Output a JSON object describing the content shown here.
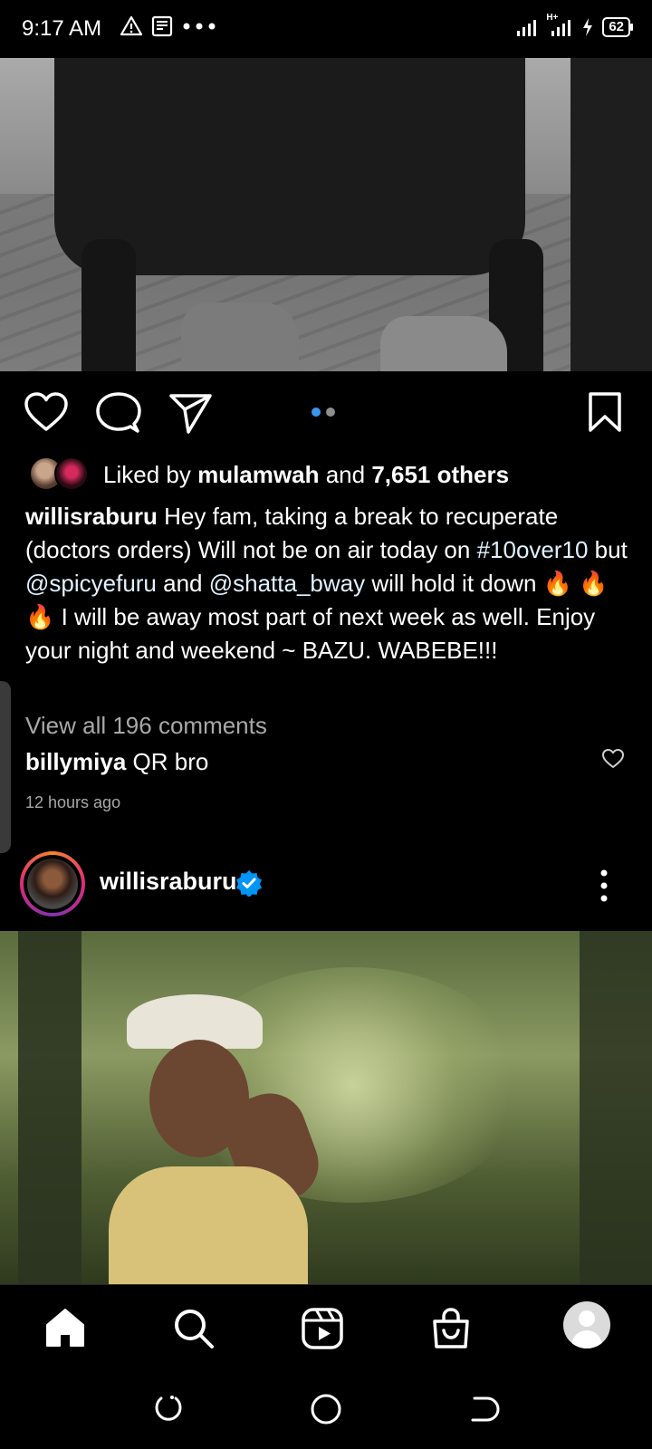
{
  "status_bar": {
    "time": "9:17 AM",
    "left_icons": [
      "alert-triangle-icon",
      "news-icon",
      "more-dots-icon"
    ],
    "right_icons": [
      "signal-icon",
      "signal-hplus-icon",
      "charging-icon"
    ],
    "network_label": "H+",
    "battery": "62"
  },
  "post1": {
    "image_icon": "photo-chair-boots",
    "carousel": {
      "total": 2,
      "active": 1
    },
    "likes": {
      "prefix": "Liked by",
      "user": "mulamwah",
      "and": "and",
      "others": "7,651 others"
    },
    "caption": {
      "username": "willisraburu",
      "part1": " Hey fam, taking a break to recuperate (doctors orders) Will not be on air today on ",
      "hashtag": "#10over10",
      "part2": " but ",
      "mention1": "@spicyefuru",
      "part3": " and ",
      "mention2": "@shatta_bway",
      "part4": " will hold it down 🔥 🔥 🔥  I will be away most part of next week as well. Enjoy your night and weekend ~ BAZU. WABEBE!!!"
    },
    "view_comments": "View all 196 comments",
    "comment": {
      "username": "billymiya",
      "text": " QR bro"
    },
    "timestamp": "12 hours ago"
  },
  "post2": {
    "username": "willisraburu",
    "verified": true,
    "image_icon": "photo-forest-portrait"
  },
  "bottom_nav": [
    "home-icon",
    "search-icon",
    "reels-icon",
    "shop-icon",
    "profile-avatar"
  ],
  "system_nav": [
    "recents-icon",
    "home-circle-icon",
    "back-icon"
  ],
  "colors": {
    "link": "#e0f1ff",
    "accent": "#3897f0",
    "verified": "#0095f6",
    "muted": "#a8a8a8"
  }
}
